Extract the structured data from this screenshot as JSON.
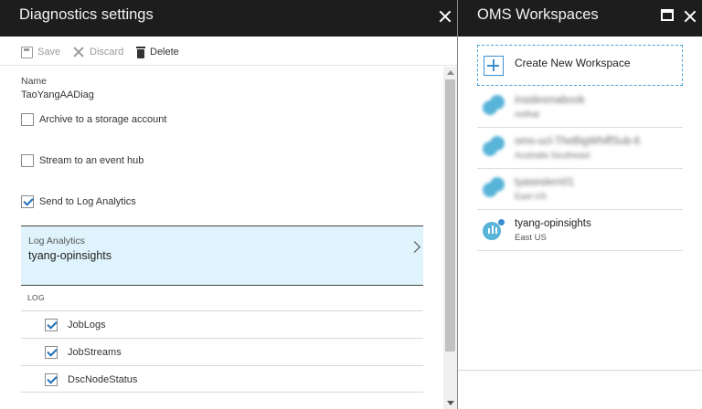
{
  "left_blade": {
    "title": "Diagnostics settings",
    "toolbar": {
      "save_label": "Save",
      "discard_label": "Discard",
      "delete_label": "Delete"
    },
    "name_label": "Name",
    "name_value": "TaoYangAADiag",
    "checkboxes": [
      {
        "label": "Archive to a storage account",
        "checked": false
      },
      {
        "label": "Stream to an event hub",
        "checked": false
      },
      {
        "label": "Send to Log Analytics",
        "checked": true
      }
    ],
    "log_analytics": {
      "label": "Log Analytics",
      "value": "tyang-opinsights"
    },
    "log_header": "LOG",
    "logs": [
      {
        "label": "JobLogs",
        "checked": true
      },
      {
        "label": "JobStreams",
        "checked": true
      },
      {
        "label": "DscNodeStatus",
        "checked": true
      }
    ]
  },
  "right_blade": {
    "title": "OMS Workspaces",
    "create_label": "Create New Workspace",
    "workspaces": [
      {
        "name": "insidesmabook",
        "location": "redhat",
        "blurred": true
      },
      {
        "name": "oms-ucl-TheBigWhiffSub-6",
        "location": "Australia Southeast",
        "blurred": true
      },
      {
        "name": "tyaseslern01",
        "location": "East US",
        "blurred": true
      },
      {
        "name": "tyang-opinsights",
        "location": "East US",
        "blurred": false
      }
    ]
  },
  "colors": {
    "header_bg": "#1d1d1d",
    "selected_bg": "#def3fb",
    "accent": "#1e6fb8"
  }
}
